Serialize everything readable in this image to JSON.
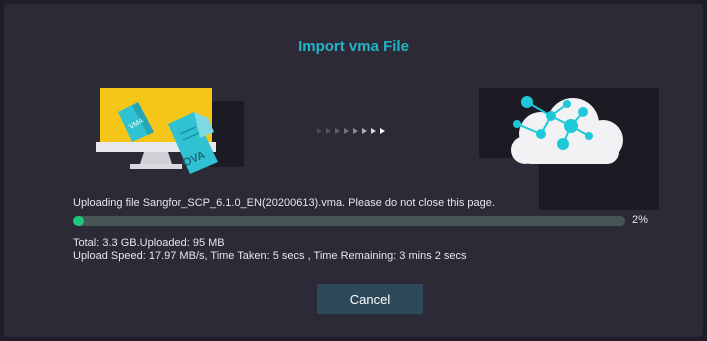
{
  "dialog": {
    "title": "Import vma File",
    "message": "Uploading file Sangfor_SCP_6.1.0_EN(20200613).vma. Please do not close this page.",
    "progress_percent": 2,
    "progress_label": "2%",
    "stats_line_1": "Total: 3.3 GB.Uploaded: 95 MB",
    "stats_line_2": "Upload Speed: 17.97 MB/s, Time Taken: 5 secs , Time Remaining: 3 mins 2 secs",
    "cancel_label": "Cancel"
  },
  "illustration": {
    "left_icon": "computer-with-files-icon",
    "file_labels": [
      "VMA",
      "OVA"
    ],
    "right_icon": "cloud-network-icon",
    "arrow_count": 8
  },
  "colors": {
    "background": "#1f1e28",
    "dialog": "#2b2a36",
    "title": "#21b5c9",
    "progress_fill": "#1ec87a",
    "progress_track": "#485556",
    "button": "#2e4a5a",
    "file_teal": "#2ec2d2",
    "monitor_yellow": "#f5c518"
  }
}
